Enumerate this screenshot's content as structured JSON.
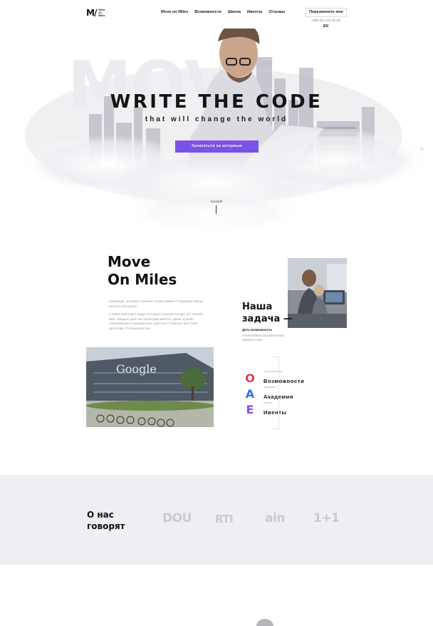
{
  "header": {
    "logo_mark": "M/",
    "logo_text": "Move on Miles",
    "nav": [
      "Move on Miles",
      "Возможности",
      "Школа",
      "Ивенты",
      "Отзывы"
    ],
    "callback_label": "Перезвоните мне",
    "phone": "+380 50 104 28 03",
    "lang": "EN"
  },
  "hero": {
    "title": "WRITE THE CODE",
    "subtitle": "that will change the world",
    "cta_label": "Записаться на интервью",
    "scroll_label": "scroll",
    "side_mark": "01"
  },
  "about": {
    "title_line1": "Move",
    "title_line2": "On Miles",
    "para1": "Компания, которая помогает талантливым IT-разработчикам достичь большего.",
    "para2": "С MOM работают люди, которые строили Google, EA Games, IBM. Каждые день мы проводим ивенты, даем лучшее образование и возможность работать в Европе или США десяткам IT-специалистов.",
    "task_title": "Наша задача —",
    "task_subtitle": "Дать возможность",
    "task_desc": "талантливым разработчикам изменить мир."
  },
  "features": [
    {
      "letter": "O",
      "small": "Предоставляем",
      "label": "Возможности",
      "color": "#e8364a"
    },
    {
      "letter": "A",
      "small": "Академия",
      "label": "Академия",
      "color": "#2f6fe8"
    },
    {
      "letter": "E",
      "small": "Ивенты",
      "label": "Ивенты",
      "color": "#8b4fe0"
    }
  ],
  "press": {
    "title": "О нас говорят",
    "logos": [
      "DOU",
      "RTI",
      "ain",
      "1+1"
    ]
  },
  "colors": {
    "accent": "#7a52e8",
    "press_bg": "#efeff3"
  }
}
